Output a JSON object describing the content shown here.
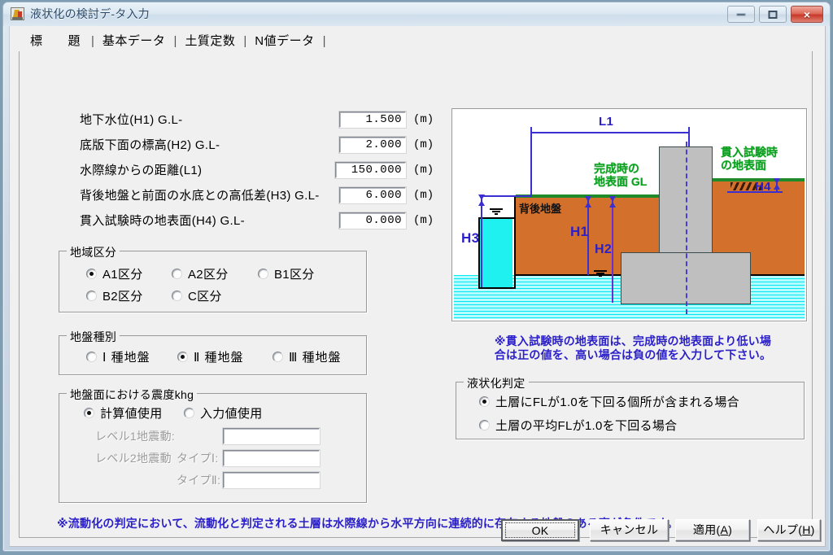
{
  "window": {
    "title": "液状化の検討デ-タ入力",
    "icon": "app-icon",
    "buttons": {
      "minimize": "minimize-icon",
      "maximize": "maximize-icon",
      "close": "×"
    }
  },
  "tabs": [
    {
      "label": "標　　題",
      "active": false
    },
    {
      "label": "基本データ",
      "active": true
    },
    {
      "label": "土質定数",
      "active": false
    },
    {
      "label": "N値データ",
      "active": false
    }
  ],
  "tab_separator": "|",
  "form": {
    "rows": [
      {
        "label": "地下水位(H1)  G.L-",
        "value": "1.500",
        "unit": "(m)"
      },
      {
        "label": "底版下面の標高(H2) G.L-",
        "value": "2.000",
        "unit": "(m)"
      },
      {
        "label": "水際線からの距離(L1)",
        "value": "150.000",
        "unit": "(m)"
      },
      {
        "label": "背後地盤と前面の水底との高低差(H3) G.L-",
        "value": "6.000",
        "unit": "(m)"
      },
      {
        "label": "貫入試験時の地表面(H4) G.L-",
        "value": "0.000",
        "unit": "(m)"
      }
    ]
  },
  "region_group": {
    "legend": "地域区分",
    "options": [
      {
        "label": "A1区分",
        "selected": true
      },
      {
        "label": "A2区分",
        "selected": false
      },
      {
        "label": "B1区分",
        "selected": false
      },
      {
        "label": "B2区分",
        "selected": false
      },
      {
        "label": "C区分",
        "selected": false
      }
    ]
  },
  "ground_group": {
    "legend": "地盤種別",
    "options": [
      {
        "label": "Ⅰ 種地盤",
        "selected": false
      },
      {
        "label": "Ⅱ 種地盤",
        "selected": true
      },
      {
        "label": "Ⅲ 種地盤",
        "selected": false
      }
    ]
  },
  "khg_group": {
    "legend": "地盤面における震度khg",
    "options": [
      {
        "label": "計算値使用",
        "selected": true
      },
      {
        "label": "入力値使用",
        "selected": false
      }
    ],
    "fields": [
      {
        "label": "レベル1地震動:",
        "value": "",
        "disabled": true
      },
      {
        "label": "レベル2地震動　タイプⅠ:",
        "value": "",
        "disabled": true
      },
      {
        "label": "タイプⅡ:",
        "value": "",
        "disabled": true
      }
    ],
    "field_labels": {
      "level1": "レベル1地震動:",
      "level2": "レベル2地震動",
      "type1": "タイプⅠ:",
      "type2": "タイプⅡ:"
    }
  },
  "liquefaction_group": {
    "legend": "液状化判定",
    "options": [
      {
        "label": "土層にFLが1.0を下回る個所が含まれる場合",
        "selected": true
      },
      {
        "label": "土層の平均FLが1.0を下回る場合",
        "selected": false
      }
    ]
  },
  "diagram": {
    "labels": {
      "l1": "L1",
      "h1": "H1",
      "h2": "H2",
      "h3": "H3",
      "h4": "H4",
      "ground_complete": "完成時の\n地表面 GL",
      "ground_complete_line1": "完成時の",
      "ground_complete_line2": "地表面 GL",
      "ground_test_line1": "貫入試験時",
      "ground_test_line2": "の地表面",
      "backfill": "背後地盤"
    },
    "colors": {
      "soil": "#d2702c",
      "water": "#1ff0f0",
      "concrete": "#bfbfbf",
      "surface_line": "#1f8a2a",
      "dimension": "#3a2fd0",
      "green_text": "#0aa01e"
    }
  },
  "notes": {
    "figure_note_line1": "※貫入試験時の地表面は、完成時の地表面より低い場",
    "figure_note_line2": "合は正の値を、高い場合は負の値を入力して下さい。",
    "bottom_note": "※流動化の判定において、流動化と判定される土層は水際線から水平方向に連続的に存在する地盤のある事が条件です。"
  },
  "footer_buttons": {
    "ok": "OK",
    "cancel": "キャンセル",
    "apply_pre": "適用(",
    "apply_key": "A",
    "apply_post": ")",
    "help_pre": "ヘルプ(",
    "help_key": "H",
    "help_post": ")"
  }
}
